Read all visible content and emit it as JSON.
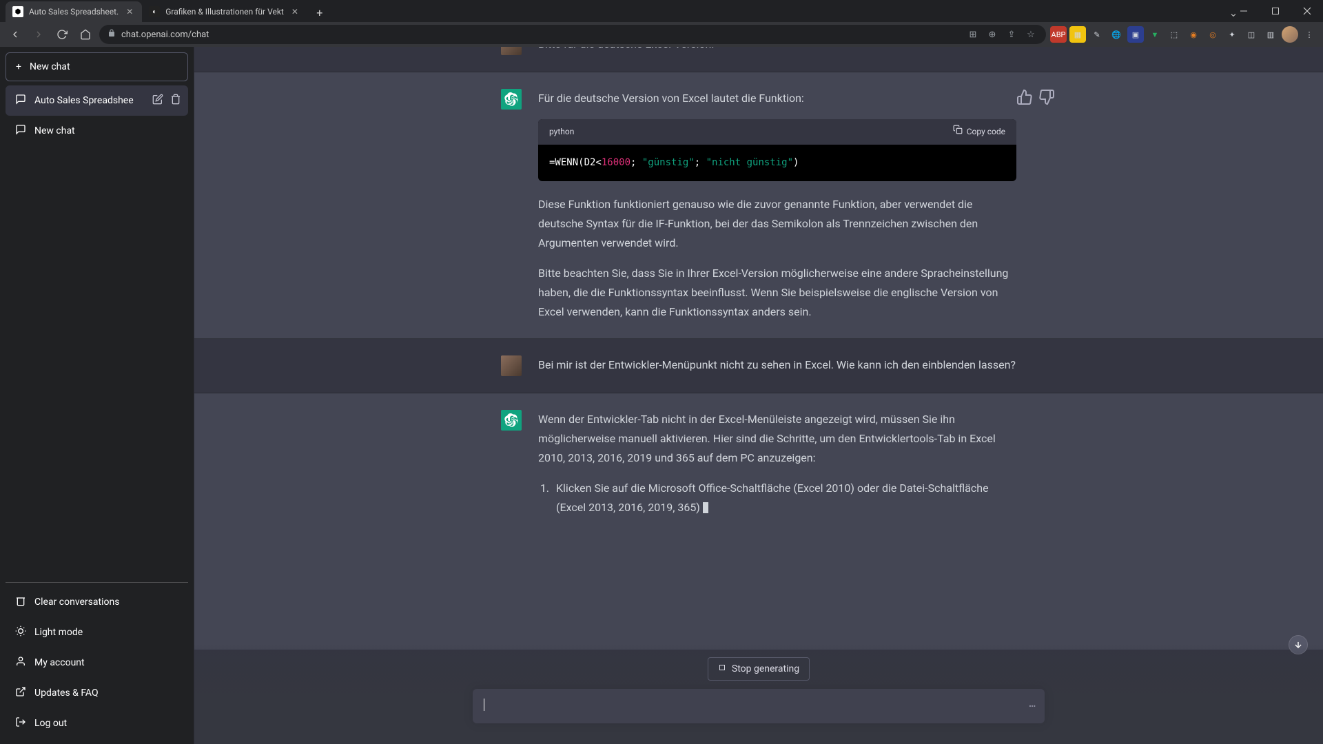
{
  "window": {
    "tabs": [
      {
        "title": "Auto Sales Spreadsheet.",
        "active": true,
        "favicon": "chat"
      },
      {
        "title": "Grafiken & Illustrationen für Vekt",
        "active": false,
        "favicon": "v"
      }
    ]
  },
  "browser": {
    "url": "chat.openai.com/chat"
  },
  "sidebar": {
    "new_chat": "New chat",
    "conversations": [
      {
        "title": "Auto Sales Spreadshee",
        "active": true
      },
      {
        "title": "New chat",
        "active": false
      }
    ],
    "footer": {
      "clear": "Clear conversations",
      "light": "Light mode",
      "account": "My account",
      "updates": "Updates & FAQ",
      "logout": "Log out"
    }
  },
  "chat": {
    "messages": [
      {
        "role": "user",
        "text": "Bitte für die deutsche Excel-Version."
      },
      {
        "role": "assistant",
        "intro": "Für die deutsche Version von Excel lautet die Funktion:",
        "code": {
          "lang": "python",
          "copy_label": "Copy code",
          "formula_prefix": "=WENN(D2<",
          "formula_num": "16000",
          "formula_mid": "; ",
          "formula_str1": "\"günstig\"",
          "formula_sep": "; ",
          "formula_str2": "\"nicht günstig\"",
          "formula_end": ")"
        },
        "para1": "Diese Funktion funktioniert genauso wie die zuvor genannte Funktion, aber verwendet die deutsche Syntax für die IF-Funktion, bei der das Semikolon als Trennzeichen zwischen den Argumenten verwendet wird.",
        "para2": "Bitte beachten Sie, dass Sie in Ihrer Excel-Version möglicherweise eine andere Spracheinstellung haben, die die Funktionssyntax beeinflusst. Wenn Sie beispielsweise die englische Version von Excel verwenden, kann die Funktionssyntax anders sein."
      },
      {
        "role": "user",
        "text": "Bei mir ist der Entwickler-Menüpunkt nicht zu sehen in Excel. Wie kann ich den einblenden lassen?"
      },
      {
        "role": "assistant",
        "intro": "Wenn der Entwickler-Tab nicht in der Excel-Menüleiste angezeigt wird, müssen Sie ihn möglicherweise manuell aktivieren. Hier sind die Schritte, um den Entwicklertools-Tab in Excel 2010, 2013, 2016, 2019 und 365 auf dem PC anzuzeigen:",
        "list_1": "Klicken Sie auf die Microsoft Office-Schaltfläche (Excel 2010) oder die Datei-Schaltfläche (Excel 2013, 2016, 2019, 365)"
      }
    ],
    "stop_generating": "Stop generating"
  }
}
